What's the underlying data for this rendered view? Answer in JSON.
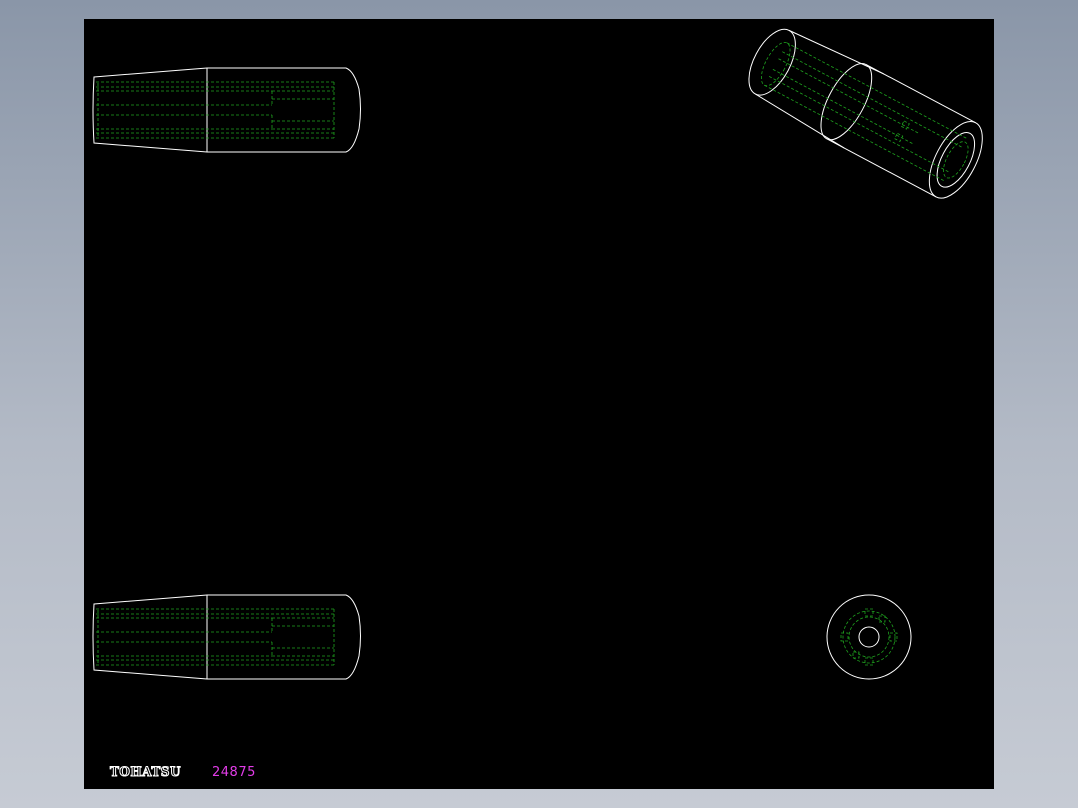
{
  "title_block": {
    "brand": "TOHATSU",
    "part_number": "24875"
  },
  "colors": {
    "background": "#000000",
    "outline": "#ffffff",
    "hidden_lines": "#1fa31f",
    "part_number_text": "#e23ce8",
    "viewport_frame": "#8f9aab"
  },
  "views": [
    {
      "name": "side-view-top"
    },
    {
      "name": "isometric-view"
    },
    {
      "name": "side-view-bottom"
    },
    {
      "name": "end-view"
    }
  ]
}
